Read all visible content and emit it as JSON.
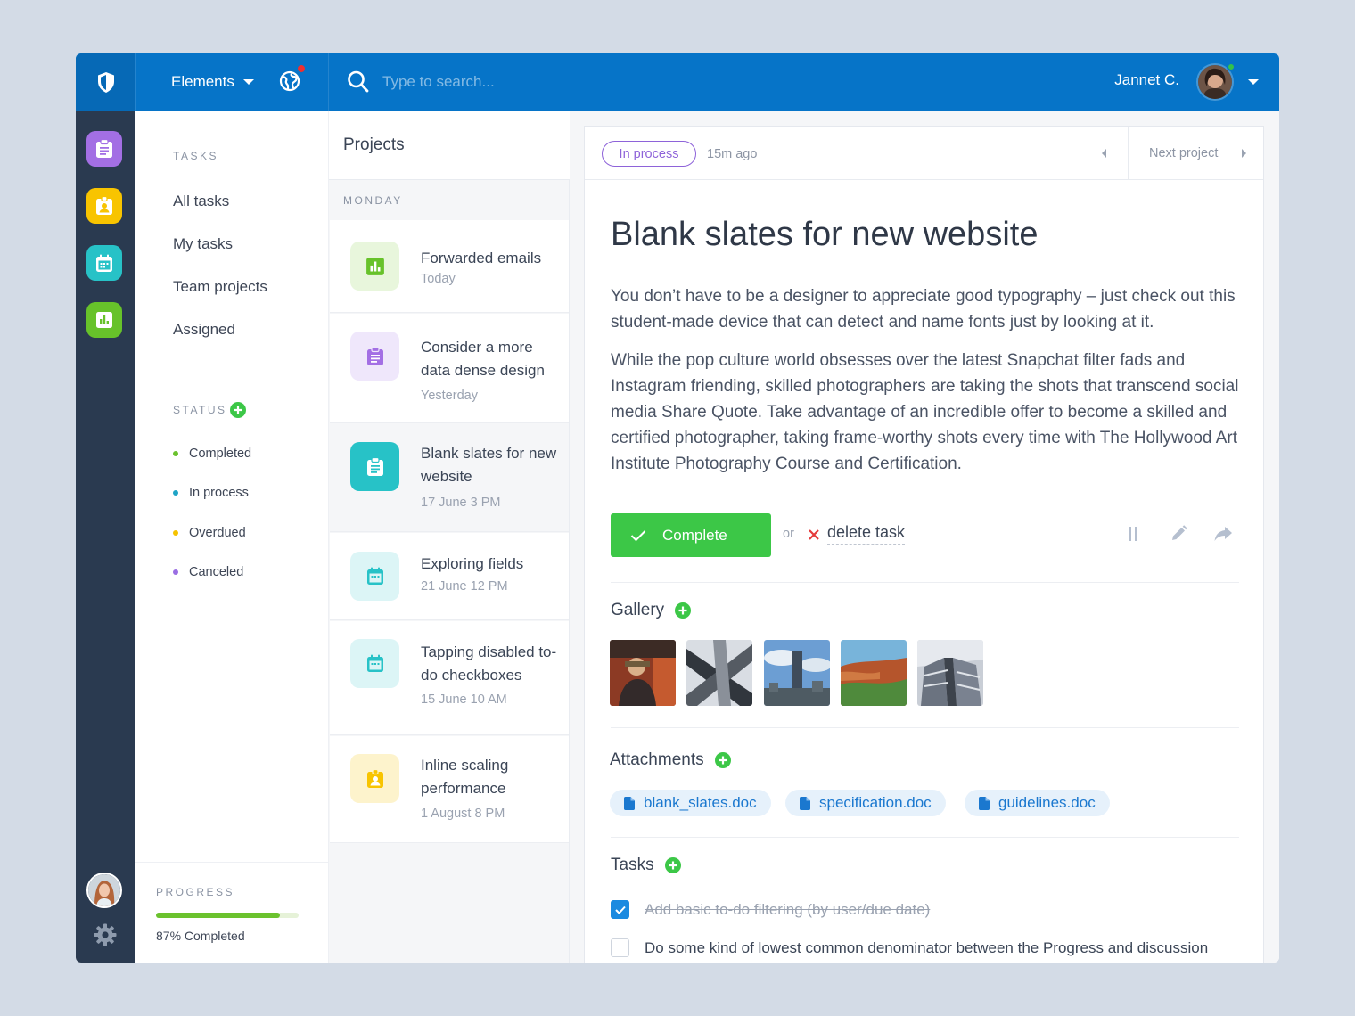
{
  "topbar": {
    "logo": "shield-icon",
    "menu_label": "Elements",
    "search_placeholder": "Type to search...",
    "user_name": "Jannet C."
  },
  "rail": {
    "items": [
      "clipboard-list-icon",
      "contact-card-icon",
      "calendar-icon",
      "bar-chart-icon"
    ],
    "colors": [
      "#a36fe4",
      "#f8c400",
      "#27c2c7",
      "#67c22a"
    ]
  },
  "sidenav": {
    "tasks_label": "TASKS",
    "tasks": [
      "All tasks",
      "My tasks",
      "Team projects",
      "Assigned"
    ],
    "status_label": "STATUS",
    "statuses": [
      {
        "label": "Completed",
        "color": "#6bc22e"
      },
      {
        "label": "In process",
        "color": "#1fa4c6"
      },
      {
        "label": "Overdued",
        "color": "#f5c300"
      },
      {
        "label": "Canceled",
        "color": "#9a6ee3"
      }
    ],
    "progress_label": "PROGRESS",
    "progress_value": 87,
    "progress_text": "87% Completed"
  },
  "projects": {
    "title": "Projects",
    "day": "MONDAY",
    "items": [
      {
        "title": "Forwarded emails",
        "date": "Today",
        "icon": "bar-chart-icon"
      },
      {
        "title": "Consider a more data dense design",
        "date": "Yesterday",
        "icon": "clipboard-list-icon"
      },
      {
        "title": "Blank slates for new website",
        "date": "17 June 3 PM",
        "icon": "clipboard-list-icon"
      },
      {
        "title": "Exploring fields",
        "date": "21 June 12 PM",
        "icon": "calendar-icon"
      },
      {
        "title": "Tapping disabled to-do checkboxes",
        "date": "15 June 10 AM",
        "icon": "calendar-icon"
      },
      {
        "title": "Inline scaling performance",
        "date": "1 August 8 PM",
        "icon": "contact-card-icon"
      }
    ]
  },
  "detail": {
    "status": "In process",
    "time_ago": "15m ago",
    "next_label": "Next project",
    "title": "Blank slates for new website",
    "para1": "You don’t have to be a designer to appreciate good typography – just check out this student-made device that can detect and name fonts just by looking at it.",
    "para2": "While the pop culture world obsesses over the latest Snapchat filter fads and Instagram friending, skilled photographers are taking the shots that transcend social media Share Quote. Take advantage of an incredible offer to become a skilled and certified photographer, taking frame-worthy shots every time with The Hollywood Art Institute Photography Course and Certification.",
    "complete_label": "Complete",
    "or_label": "or",
    "delete_label": "delete task",
    "gallery_title": "Gallery",
    "attachments_title": "Attachments",
    "attachments": [
      "blank_slates.doc",
      "specification.doc",
      "guidelines.doc"
    ],
    "tasks_title": "Tasks",
    "tasks": [
      {
        "text": "Add basic to-do filtering (by user/due date)",
        "done": true
      },
      {
        "text": "Do some kind of lowest common denominator between the Progress and discussion",
        "done": false
      }
    ]
  }
}
